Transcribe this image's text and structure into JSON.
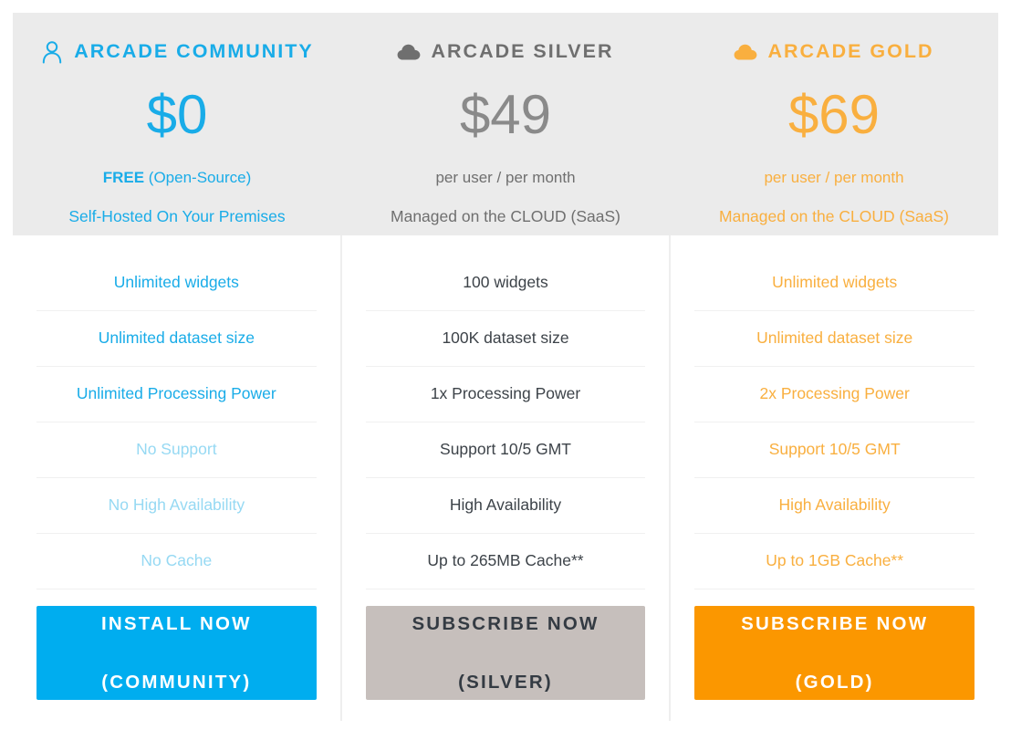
{
  "colors": {
    "community": "#19ACE8",
    "community_muted": "#96D9F3",
    "silver": "#6F6F6F",
    "silver_text": "#3D4349",
    "gold": "#F9AF3F",
    "gold_strong": "#FB9700",
    "header_bg": "#EBEBEB",
    "divider": "#F0F0F0",
    "silver_button_bg": "#C6BFBC",
    "silver_button_text": "#343B43",
    "white": "#FFFFFF"
  },
  "plans": [
    {
      "id": "community",
      "icon": "user-icon",
      "title": "ARCADE COMMUNITY",
      "price": "$0",
      "sub1_strong": "FREE",
      "sub1_rest": " (Open-Source)",
      "sub2": "Self-Hosted On Your Premises",
      "features": [
        {
          "label": "Unlimited widgets",
          "muted": false
        },
        {
          "label": "Unlimited dataset size",
          "muted": false
        },
        {
          "label": "Unlimited Processing Power",
          "muted": false
        },
        {
          "label": "No Support",
          "muted": true
        },
        {
          "label": "No High Availability",
          "muted": true
        },
        {
          "label": "No Cache",
          "muted": true
        }
      ],
      "cta_line1": "INSTALL NOW",
      "cta_line2": "(COMMUNITY)"
    },
    {
      "id": "silver",
      "icon": "cloud-icon",
      "title": "ARCADE SILVER",
      "price": "$49",
      "sub1_strong": "",
      "sub1_rest": "per user / per month",
      "sub2": "Managed on the CLOUD (SaaS)",
      "features": [
        {
          "label": "100 widgets",
          "muted": false
        },
        {
          "label": "100K dataset size",
          "muted": false
        },
        {
          "label": "1x Processing Power",
          "muted": false
        },
        {
          "label": "Support 10/5 GMT",
          "muted": false
        },
        {
          "label": "High Availability",
          "muted": false
        },
        {
          "label": "Up to 265MB Cache**",
          "muted": false
        }
      ],
      "cta_line1": "SUBSCRIBE NOW",
      "cta_line2": "(SILVER)"
    },
    {
      "id": "gold",
      "icon": "cloud-icon",
      "title": "ARCADE GOLD",
      "price": "$69",
      "sub1_strong": "",
      "sub1_rest": "per user / per month",
      "sub2": "Managed on the CLOUD (SaaS)",
      "features": [
        {
          "label": "Unlimited widgets",
          "muted": false
        },
        {
          "label": "Unlimited dataset size",
          "muted": false
        },
        {
          "label": "2x Processing Power",
          "muted": false
        },
        {
          "label": "Support 10/5 GMT",
          "muted": false
        },
        {
          "label": "High Availability",
          "muted": false
        },
        {
          "label": "Up to 1GB Cache**",
          "muted": false
        }
      ],
      "cta_line1": "SUBSCRIBE NOW",
      "cta_line2": "(GOLD)"
    }
  ]
}
